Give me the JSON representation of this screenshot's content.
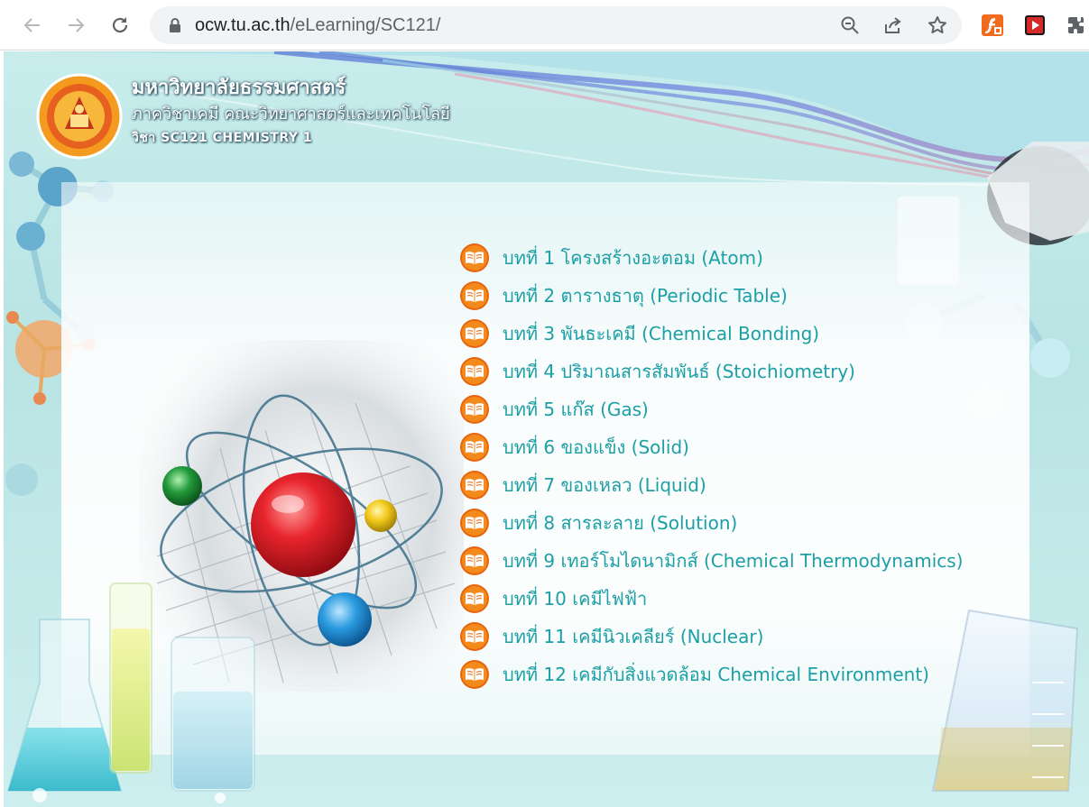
{
  "browser": {
    "url_host": "ocw.tu.ac.th",
    "url_path": "/eLearning/SC121/"
  },
  "header": {
    "university": "มหาวิทยาลัยธรรมศาสตร์",
    "department": "ภาควิชาเคมี คณะวิทยาศาสตร์และเทคโนโลยี",
    "course": "วิชา SC121 CHEMISTRY 1"
  },
  "chapters": [
    {
      "label": "บทที่ 1 โครงสร้างอะตอม (Atom)"
    },
    {
      "label": "บทที่ 2 ตารางธาตุ (Periodic Table)"
    },
    {
      "label": "บทที่ 3 พันธะเคมี (Chemical Bonding)"
    },
    {
      "label": "บทที่ 4 ปริมาณสารสัมพันธ์ (Stoichiometry)"
    },
    {
      "label": "บทที่ 5 แก๊ส (Gas)"
    },
    {
      "label": "บทที่ 6 ของแข็ง (Solid)"
    },
    {
      "label": "บทที่ 7 ของเหลว (Liquid)"
    },
    {
      "label": "บทที่ 8 สารละลาย (Solution)"
    },
    {
      "label": "บทที่ 9 เทอร์โมไดนามิกส์ (Chemical Thermodynamics)"
    },
    {
      "label": "บทที่ 10 เคมีไฟฟ้า"
    },
    {
      "label": "บทที่ 11 เคมีนิวเคลียร์ (Nuclear)"
    },
    {
      "label": "บทที่ 12 เคมีกับสิ่งแวดล้อม Chemical Environment)"
    }
  ],
  "colors": {
    "link": "#1c9fa5",
    "icon_orange": "#e8650f",
    "background": "#c8ecec"
  },
  "icons": {
    "chapter": "book-icon",
    "back": "arrow-left-icon",
    "forward": "arrow-right-icon",
    "reload": "reload-icon",
    "lock": "lock-icon",
    "zoom": "zoom-out-icon",
    "share": "share-icon",
    "bookmark": "star-icon",
    "extensions": "puzzle-icon"
  }
}
